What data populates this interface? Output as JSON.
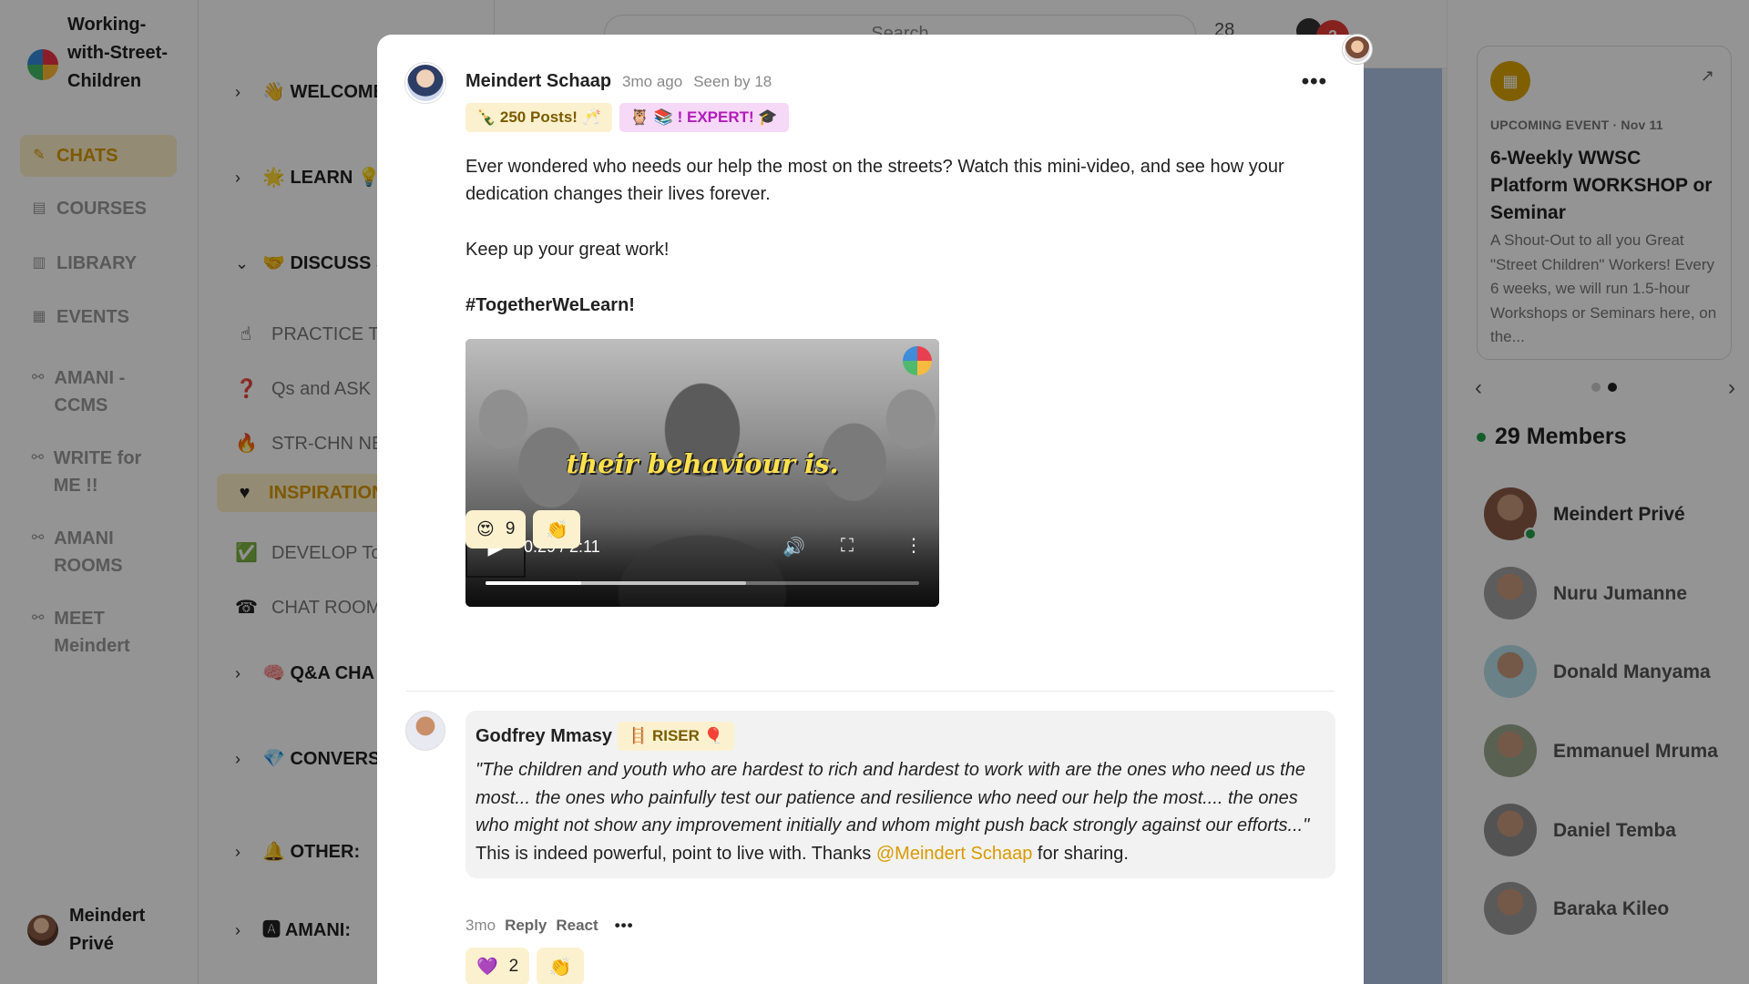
{
  "sidebar": {
    "community_name": "Working-with-Street-Children",
    "items": [
      {
        "label": "CHATS",
        "icon": "pencil-icon",
        "glyph": "✎",
        "active": true
      },
      {
        "label": "COURSES",
        "icon": "book-icon",
        "glyph": "▤",
        "active": false
      },
      {
        "label": "LIBRARY",
        "icon": "document-icon",
        "glyph": "▥",
        "active": false
      },
      {
        "label": "EVENTS",
        "icon": "calendar-icon",
        "glyph": "▦",
        "active": false
      },
      {
        "label": "AMANI - CCMS",
        "icon": "link-icon",
        "glyph": "⚯",
        "active": false
      },
      {
        "label": "WRITE for ME !!",
        "icon": "link-icon",
        "glyph": "⚯",
        "active": false
      },
      {
        "label": "AMANI ROOMS",
        "icon": "link-icon",
        "glyph": "⚯",
        "active": false
      },
      {
        "label": "MEET Meindert",
        "icon": "link-icon",
        "glyph": "⚯",
        "active": false
      }
    ],
    "user_name": "Meindert Privé"
  },
  "channels": [
    {
      "type": "group",
      "label": "👋 WELCOME to USE:",
      "chevron": "›"
    },
    {
      "type": "group",
      "label": "🌟 LEARN 💡 with Street C",
      "chevron": "›"
    },
    {
      "type": "group",
      "label": "🤝 DISCUSS SHARE:",
      "chevron": "⌄"
    },
    {
      "type": "channel",
      "icon": "☝",
      "label": "PRACTICE T"
    },
    {
      "type": "channel",
      "icon": "❓",
      "label": "Qs and ASK"
    },
    {
      "type": "channel",
      "icon": "🔥",
      "label": "STR-CHN NE"
    },
    {
      "type": "channel",
      "icon": "♥",
      "label": "INSPIRATION",
      "active": true
    },
    {
      "type": "channel",
      "icon": "✅",
      "label": "DEVELOP To"
    },
    {
      "type": "channel",
      "icon": "☎",
      "label": "CHAT ROOM"
    },
    {
      "type": "group",
      "label": "🧠 Q&A CHA and APPS:",
      "chevron": "›"
    },
    {
      "type": "group",
      "label": "💎 CONVERS Training",
      "chevron": "›"
    },
    {
      "type": "group",
      "label": "🔔 OTHER:",
      "chevron": "›"
    },
    {
      "type": "group",
      "label": "🅰 AMANI:",
      "chevron": "›"
    }
  ],
  "topbar": {
    "search_placeholder": "Search",
    "count": "28",
    "notifications": "2"
  },
  "event": {
    "kicker": "UPCOMING EVENT · Nov 11",
    "title": "6-Weekly WWSC Platform WORKSHOP or Seminar",
    "description": "A Shout-Out to all you Great \"Street Children\" Workers! Every 6 weeks, we will run 1.5-hour Workshops or Seminars here, on the..."
  },
  "members": {
    "count_label": "29 Members",
    "list": [
      {
        "name": "Meindert Privé",
        "online": true
      },
      {
        "name": "Nuru Jumanne",
        "online": false
      },
      {
        "name": "Donald Manyama",
        "online": false
      },
      {
        "name": "Emmanuel Mruma",
        "online": false
      },
      {
        "name": "Daniel Temba",
        "online": false
      },
      {
        "name": "Baraka Kileo",
        "online": false
      }
    ]
  },
  "post": {
    "author": "Meindert Schaap",
    "time": "3mo ago",
    "seen": "Seen by 18",
    "badges": [
      {
        "label": "🍾 250 Posts! 🥂",
        "style": "gold"
      },
      {
        "label": "🦉 📚 ! EXPERT! 🎓",
        "style": "purple"
      }
    ],
    "paragraphs": [
      "Ever wondered who needs our help the most on the streets? Watch this mini-video, and see how your dedication changes their lives forever.",
      "Keep up your great work!"
    ],
    "hashtag": "#TogetherWeLearn!",
    "video": {
      "caption": "their behaviour is.",
      "time": "0:29 / 2:11",
      "played_fraction": 0.22,
      "buffered_fraction": 0.6
    },
    "reactions": [
      {
        "emoji": "😍",
        "count": "9"
      }
    ],
    "add_reaction_icon": "👏"
  },
  "comment": {
    "author": "Godfrey Mmasy",
    "badge": "🪜 RISER 🎈",
    "quote": "\"The children and youth who are hardest to rich and hardest to work with are the ones who need us the most... the ones who painfully test our patience and resilience who need our help the most.... the ones who might not show any improvement initially and whom might push back strongly against our efforts...\"",
    "text": " This is indeed powerful, point to live with. Thanks ",
    "mention": "@Meindert Schaap",
    "text_end": " for sharing.",
    "time": "3mo",
    "reply_label": "Reply",
    "react_label": "React",
    "more_label": "•••",
    "reactions": [
      {
        "emoji": "💜",
        "count": "2"
      }
    ]
  },
  "colors": {
    "accent": "#d99a00",
    "accent_bg": "#fdefc8",
    "purple_badge": "#b01cb9",
    "online": "#22a04b",
    "notification": "#e53935"
  }
}
